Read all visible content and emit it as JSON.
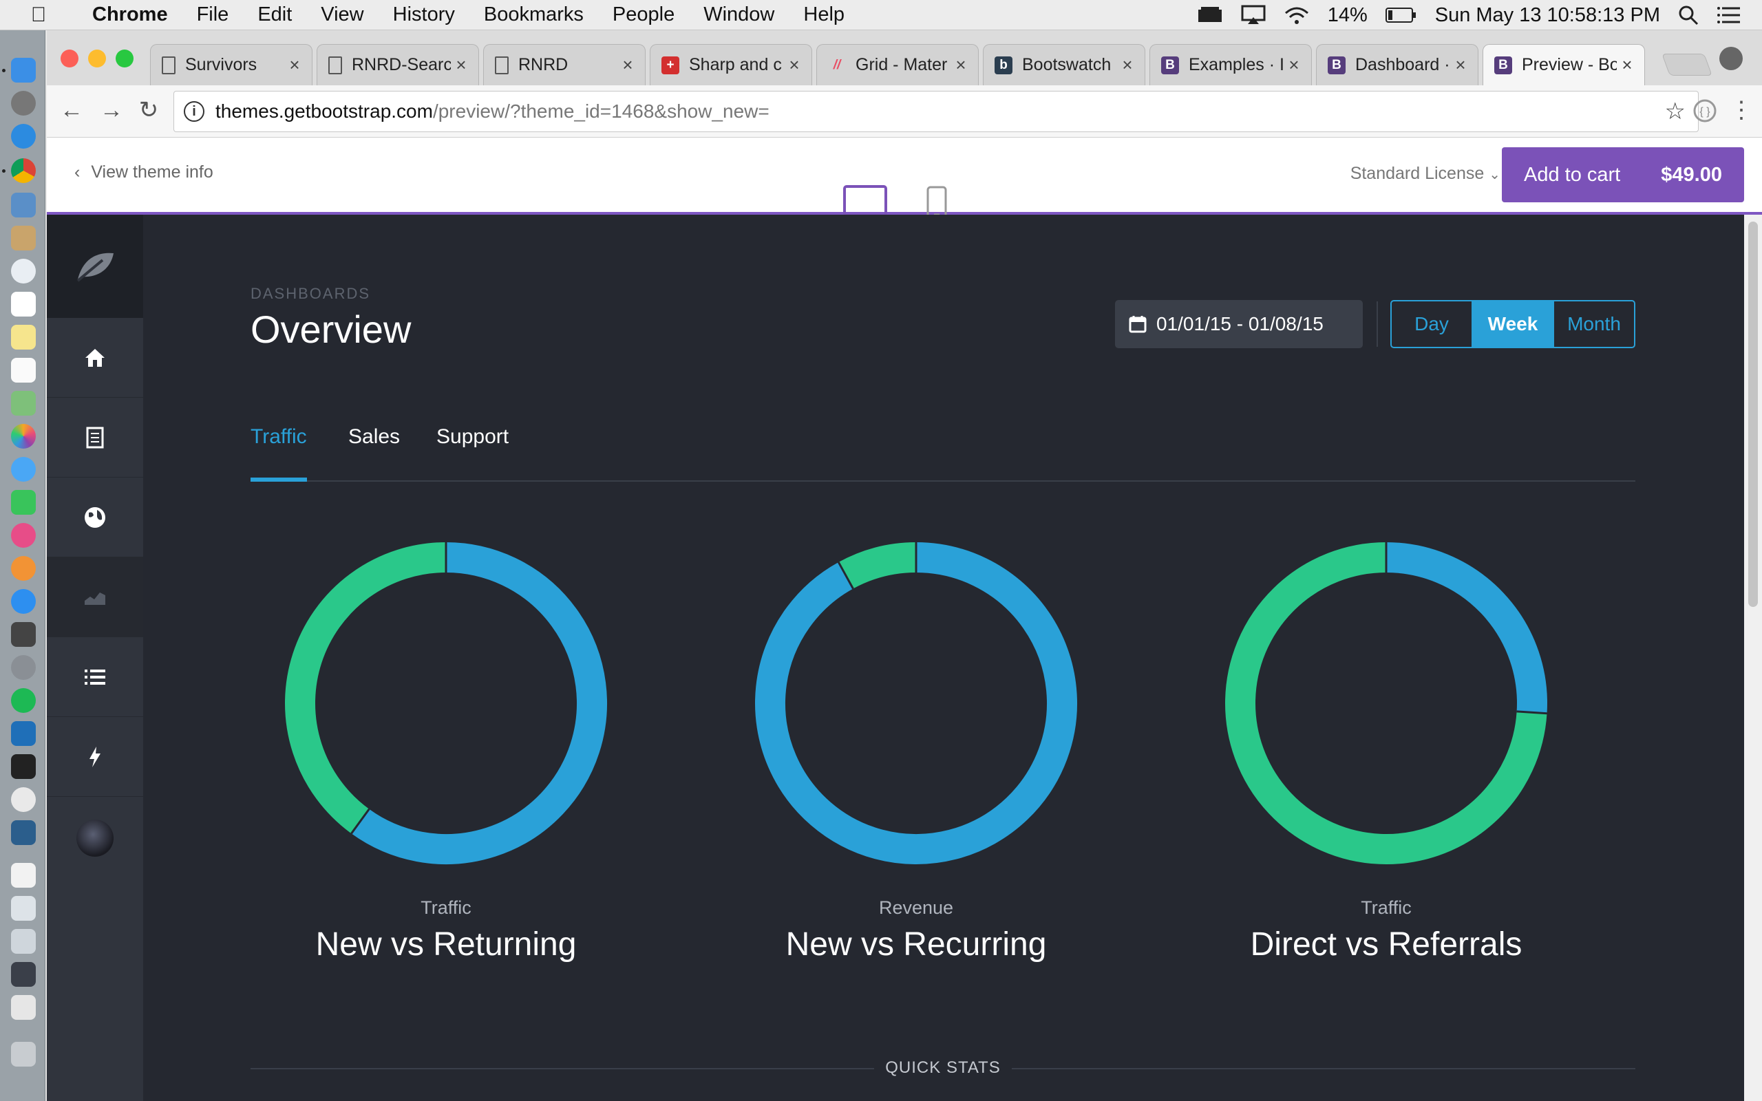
{
  "menubar": {
    "app": "Chrome",
    "items": [
      "File",
      "Edit",
      "View",
      "History",
      "Bookmarks",
      "People",
      "Window",
      "Help"
    ],
    "battery": "14%",
    "clock": "Sun May 13  10:58:13 PM"
  },
  "browser": {
    "tabs": [
      {
        "title": "Survivors",
        "icon": "document-icon"
      },
      {
        "title": "RNRD-Search",
        "icon": "document-icon"
      },
      {
        "title": "RNRD",
        "icon": "document-icon"
      },
      {
        "title": "Sharp and c",
        "icon": "red-cross-icon"
      },
      {
        "title": "Grid - Mater",
        "icon": "material-icon"
      },
      {
        "title": "Bootswatch",
        "icon": "bootswatch-icon"
      },
      {
        "title": "Examples · I",
        "icon": "bootstrap-icon",
        "letter": "B"
      },
      {
        "title": "Dashboard ·",
        "icon": "bootstrap-icon",
        "letter": "B"
      },
      {
        "title": "Preview - Bo",
        "icon": "bootstrap-icon",
        "letter": "B",
        "active": true
      }
    ],
    "url_host": "themes.getbootstrap.com",
    "url_path": "/preview/?theme_id=1468&show_new="
  },
  "preview_bar": {
    "back_label": "View theme info",
    "license": "Standard License",
    "cart_label": "Add to cart",
    "price": "$49.00"
  },
  "dashboard": {
    "kicker": "DASHBOARDS",
    "title": "Overview",
    "daterange": "01/01/15 - 01/08/15",
    "periods": [
      "Day",
      "Week",
      "Month"
    ],
    "selected_period": "Week",
    "tabs": [
      "Traffic",
      "Sales",
      "Support"
    ],
    "selected_tab": "Traffic",
    "colors": {
      "blue": "#2aa1d8",
      "green": "#2ac88a",
      "bg": "#252830",
      "sidebar": "#30343d"
    },
    "quick_stats_label": "QUICK STATS"
  },
  "chart_data": [
    {
      "type": "pie",
      "kicker": "Traffic",
      "title": "New vs Returning",
      "series": [
        {
          "color": "#2aa1d8",
          "value": 60
        },
        {
          "color": "#2ac88a",
          "value": 40
        }
      ]
    },
    {
      "type": "pie",
      "kicker": "Revenue",
      "title": "New vs Recurring",
      "series": [
        {
          "color": "#2aa1d8",
          "value": 92
        },
        {
          "color": "#2ac88a",
          "value": 8
        }
      ]
    },
    {
      "type": "pie",
      "kicker": "Traffic",
      "title": "Direct vs Referrals",
      "series": [
        {
          "color": "#2aa1d8",
          "value": 26
        },
        {
          "color": "#2ac88a",
          "value": 74
        }
      ]
    }
  ]
}
